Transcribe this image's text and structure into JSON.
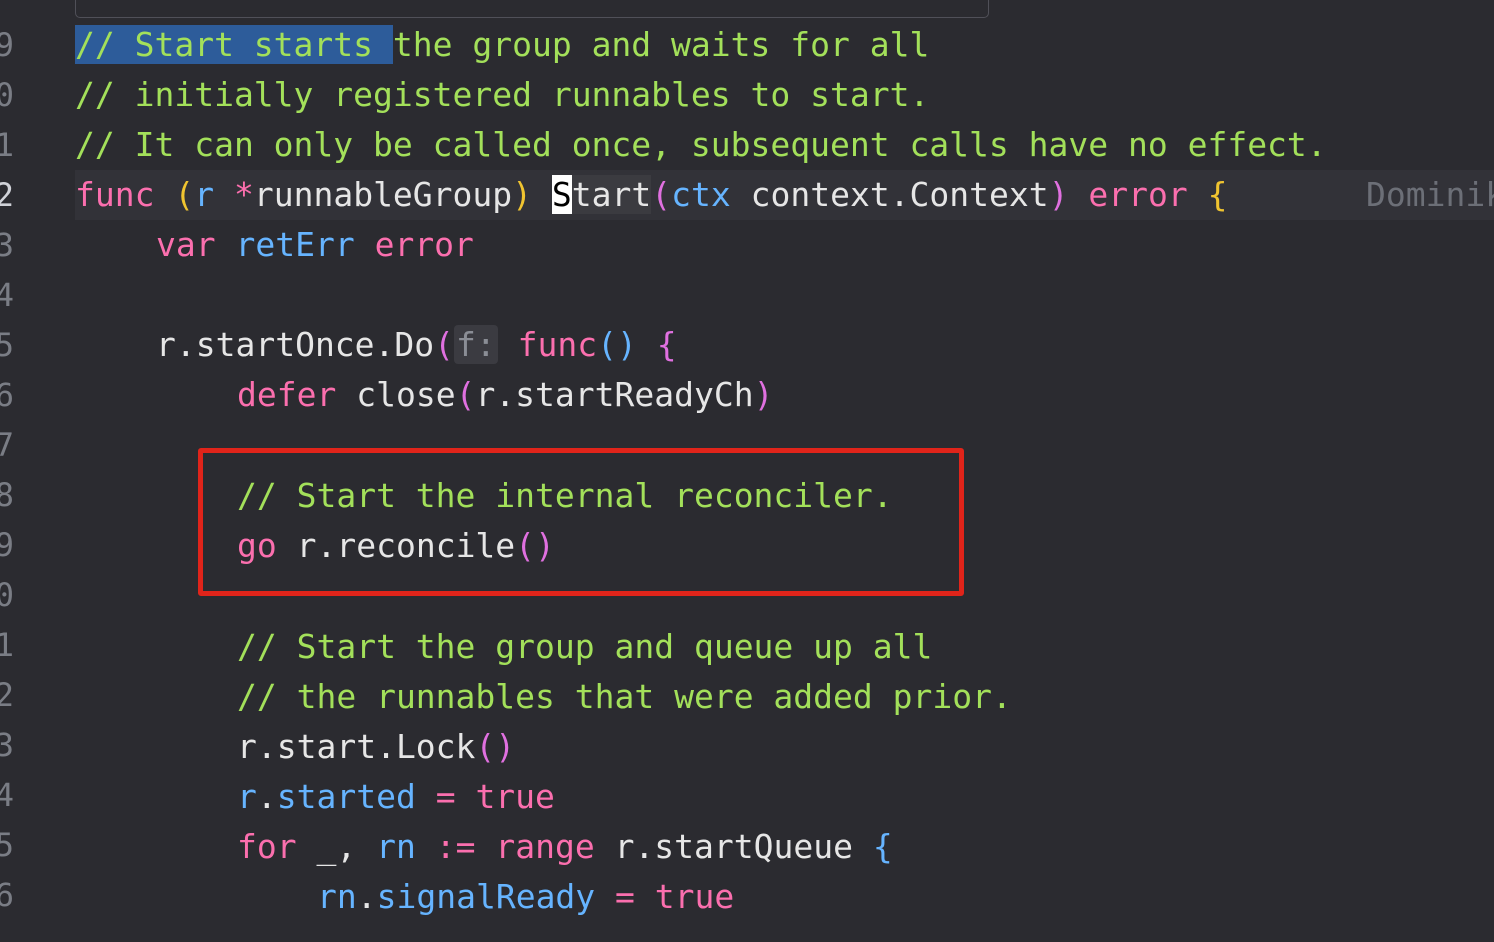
{
  "gutter": [
    "9",
    "0",
    "1",
    "2",
    "3",
    "4",
    "5",
    "6",
    "7",
    "8",
    "9",
    "0",
    "1",
    "2",
    "3",
    "4",
    "5",
    "6"
  ],
  "current_line_gutter_index": 3,
  "lines": {
    "l1": {
      "c1": "// Start starts ",
      "c2": "the group and waits for all"
    },
    "l2": {
      "c": "// initially registered runnables to start."
    },
    "l3": {
      "c": "// It can only be called once, subsequent calls have no effect."
    },
    "l4": {
      "func": "func",
      "sp1": " ",
      "lp": "(",
      "r": "r",
      "sp2": " ",
      "star": "*",
      "rg": "runnableGroup",
      "rp": ")",
      "sp3": " ",
      "S": "S",
      "tart": "tart",
      "lp2": "(",
      "ctx": "ctx",
      "sp4": " ",
      "ctxType": "context.Context",
      "rp2": ")",
      "sp5": " ",
      "err": "error",
      "sp6": " ",
      "lb": "{",
      "blame": "Dominik"
    },
    "l5": {
      "var": "var",
      "sp1": " ",
      "retErr": "retErr",
      "sp2": " ",
      "err": "error"
    },
    "l7": {
      "recv": "r.startOnce.Do",
      "lp": "(",
      "hint": "f:",
      "sp": " ",
      "func": "func",
      "paren": "()",
      "sp2": " ",
      "lb": "{"
    },
    "l8": {
      "defer": "defer",
      "sp": " ",
      "close": "close",
      "lp": "(",
      "arg": "r.startReadyCh",
      "rp": ")"
    },
    "l10": {
      "c": "// Start the internal reconciler."
    },
    "l11": {
      "go": "go",
      "sp": " ",
      "call": "r.reconcile",
      "paren": "()"
    },
    "l13": {
      "c": "// Start the group and queue up all"
    },
    "l14": {
      "c": "// the runnables that were added prior."
    },
    "l15": {
      "call": "r.start.Lock",
      "paren": "()"
    },
    "l16": {
      "r": "r",
      "dot": ".",
      "started": "started",
      "eq": " = ",
      "val": "true"
    },
    "l17": {
      "for": "for",
      "sp": " ",
      "us": "_, ",
      "rn": "rn",
      "sp2": " ",
      "assign": ":=",
      "sp3": " ",
      "range": "range",
      "sp4": " ",
      "q": "r.startQueue",
      "sp5": " ",
      "lb": "{"
    },
    "l18": {
      "rn": "rn",
      "dot": ".",
      "field": "signalReady",
      "eq": " = ",
      "val": "true"
    }
  },
  "colors": {
    "background": "#2b2b30",
    "keyword": "#fb6fae",
    "comment": "#a3e05a",
    "param": "#66b4ff",
    "brace": "#f0c430",
    "highlight_box": "#e0241a",
    "selection": "#2d5c9a"
  }
}
